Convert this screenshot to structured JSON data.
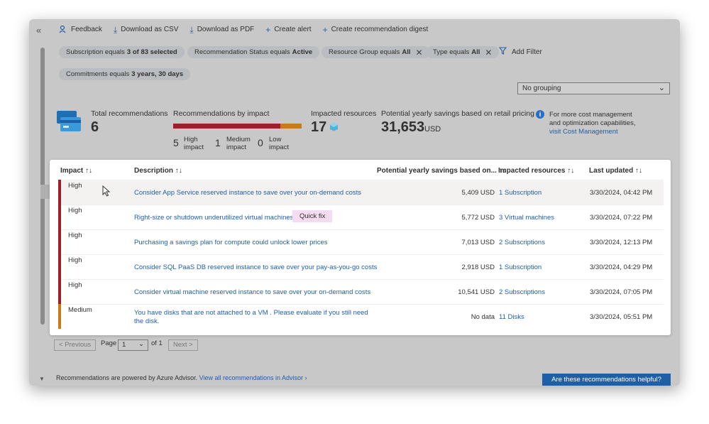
{
  "toolbar": {
    "collapse": "«",
    "feedback": "Feedback",
    "download_csv": "Download as CSV",
    "download_pdf": "Download as PDF",
    "create_alert": "Create alert",
    "create_digest": "Create recommendation digest"
  },
  "filters": {
    "subscription_label": "Subscription equals",
    "subscription_value": "3 of 83 selected",
    "status_label": "Recommendation Status equals",
    "status_value": "Active",
    "rg_label": "Resource Group equals",
    "rg_value": "All",
    "type_label": "Type equals",
    "type_value": "All",
    "add_filter": "Add Filter",
    "commitments_label": "Commitments equals",
    "commitments_value": "3 years, 30 days"
  },
  "grouping": {
    "selected": "No grouping"
  },
  "summary": {
    "total_label": "Total recommendations",
    "total_value": "6",
    "by_impact_label": "Recommendations by impact",
    "high_count": "5",
    "high_label": "High impact",
    "medium_count": "1",
    "medium_label": "Medium impact",
    "low_count": "0",
    "low_label": "Low impact",
    "impacted_label": "Impacted resources",
    "impacted_value": "17",
    "savings_label": "Potential yearly savings based on retail pricing",
    "savings_value": "31,653",
    "savings_unit": "USD",
    "info_text_1": "For more cost management",
    "info_text_2": "and optimization capabilities,",
    "info_link": "visit Cost Management"
  },
  "colors": {
    "high": "#9e1f2c",
    "medium": "#c87b1a",
    "link": "#1f5fa8",
    "button": "#1f5fa8"
  },
  "table": {
    "headers": {
      "impact": "Impact",
      "description": "Description",
      "savings": "Potential yearly savings based on...",
      "resources": "Impacted resources",
      "updated": "Last updated"
    },
    "sort_glyph": "↑↓",
    "rows": [
      {
        "impact": "High",
        "description": "Consider App Service reserved instance to save over your on-demand costs",
        "savings": "5,409 USD",
        "resources": "1 Subscription",
        "updated": "3/30/2024, 04:42 PM"
      },
      {
        "impact": "High",
        "description": "Right-size or shutdown underutilized virtual machines",
        "quick_fix": "Quick fix",
        "savings": "5,772 USD",
        "resources": "3 Virtual machines",
        "updated": "3/30/2024, 07:22 PM"
      },
      {
        "impact": "High",
        "description": "Purchasing a savings plan for compute could unlock lower prices",
        "savings": "7,013 USD",
        "resources": "2 Subscriptions",
        "updated": "3/30/2024, 12:13 PM"
      },
      {
        "impact": "High",
        "description": "Consider SQL PaaS DB reserved instance to save over your pay-as-you-go costs",
        "savings": "2,918 USD",
        "resources": "1 Subscription",
        "updated": "3/30/2024, 04:29 PM"
      },
      {
        "impact": "High",
        "description": "Consider virtual machine reserved instance to save over your on-demand costs",
        "savings": "10,541 USD",
        "resources": "2 Subscriptions",
        "updated": "3/30/2024, 07:05 PM"
      },
      {
        "impact": "Medium",
        "description": "You have disks that are not attached to a VM . Please evaluate if you still need the disk.",
        "savings": "No data",
        "resources": "11 Disks",
        "updated": "3/30/2024, 05:51 PM"
      }
    ]
  },
  "pager": {
    "previous": "< Previous",
    "page_label": "Page",
    "page_value": "1",
    "of_label": "of 1",
    "next": "Next >"
  },
  "footer": {
    "text": "Recommendations are powered by Azure Advisor.",
    "link": "View all recommendations in Advisor",
    "helpful_button": "Are these recommendations helpful?"
  }
}
